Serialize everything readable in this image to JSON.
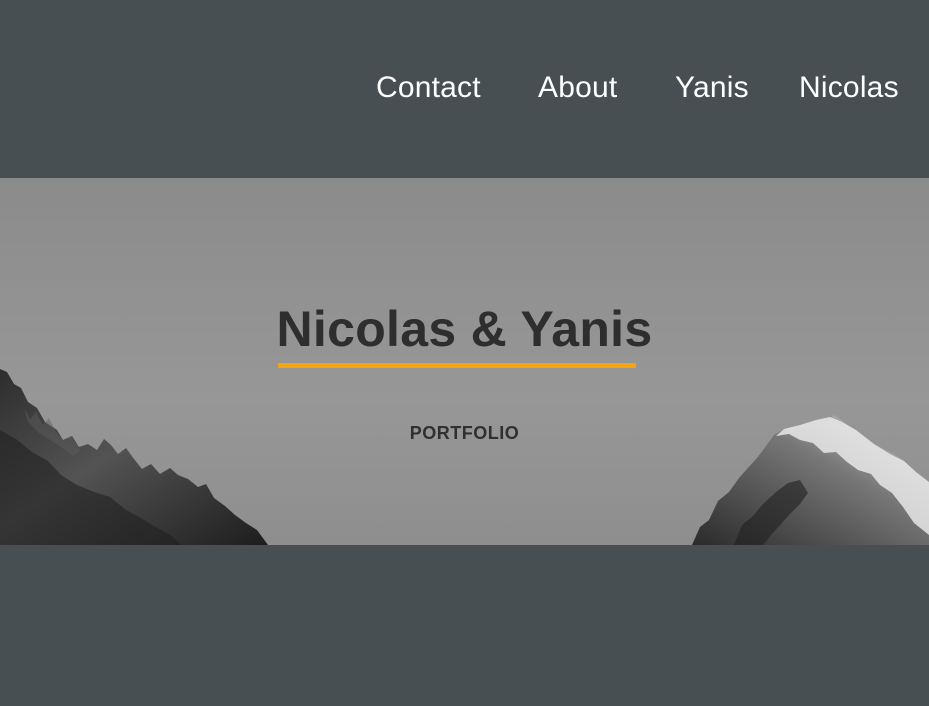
{
  "nav": {
    "items": [
      {
        "label": "Contact"
      },
      {
        "label": "About"
      },
      {
        "label": "Yanis"
      },
      {
        "label": "Nicolas"
      }
    ]
  },
  "hero": {
    "title": "Nicolas & Yanis",
    "subtitle": "PORTFOLIO",
    "background_image": "black-and-white-mountain-peaks",
    "accent_color": "#f4a40e"
  },
  "colors": {
    "page_background": "#474f52",
    "hero_background": "#929292",
    "nav_text": "#ffffff",
    "title_text": "#2e2e2e"
  }
}
